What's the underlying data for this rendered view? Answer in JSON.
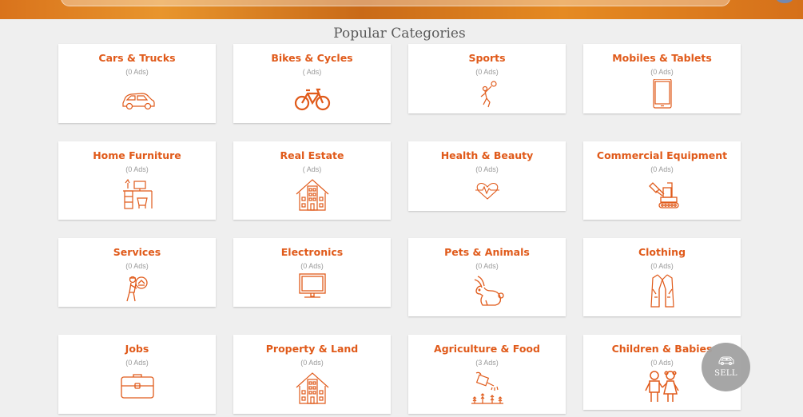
{
  "header": {
    "section_title": "Popular Categories"
  },
  "categories": [
    {
      "title": "Cars & Trucks",
      "count": "(0 Ads)",
      "icon": "car-icon"
    },
    {
      "title": "Bikes & Cycles",
      "count": "( Ads)",
      "icon": "bicycle-icon"
    },
    {
      "title": "Sports",
      "count": "(0 Ads)",
      "icon": "sports-player-icon"
    },
    {
      "title": "Mobiles & Tablets",
      "count": "(0 Ads)",
      "icon": "tablet-icon"
    },
    {
      "title": "Home Furniture",
      "count": "(0 Ads)",
      "icon": "desk-furniture-icon"
    },
    {
      "title": "Real Estate",
      "count": "( Ads)",
      "icon": "building-icon"
    },
    {
      "title": "Health & Beauty",
      "count": "(0 Ads)",
      "icon": "heartbeat-icon"
    },
    {
      "title": "Commercial Equipment",
      "count": "(0 Ads)",
      "icon": "excavator-icon"
    },
    {
      "title": "Services",
      "count": "(0 Ads)",
      "icon": "service-worker-icon"
    },
    {
      "title": "Electronics",
      "count": "(0 Ads)",
      "icon": "monitor-icon"
    },
    {
      "title": "Pets & Animals",
      "count": "(0 Ads)",
      "icon": "rabbit-icon"
    },
    {
      "title": "Clothing",
      "count": "(0 Ads)",
      "icon": "jacket-icon"
    },
    {
      "title": "Jobs",
      "count": "(0 Ads)",
      "icon": "briefcase-icon"
    },
    {
      "title": "Property & Land",
      "count": "(0 Ads)",
      "icon": "building-icon"
    },
    {
      "title": "Agriculture & Food",
      "count": "(3 Ads)",
      "icon": "watering-can-icon"
    },
    {
      "title": "Children & Babies",
      "count": "(0 Ads)",
      "icon": "children-icon"
    }
  ],
  "sell_button": {
    "label": "SELL",
    "icon": "car-icon"
  },
  "colors": {
    "accent": "#e05a1a",
    "page_background": "#efefef",
    "card_background": "#ffffff",
    "sell_button": "#a2a2a2",
    "muted_text": "#9a9a9a"
  }
}
